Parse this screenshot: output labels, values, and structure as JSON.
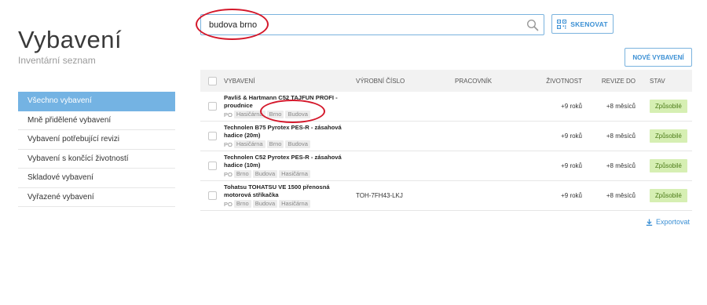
{
  "header": {
    "title": "Vybavení",
    "subtitle": "Inventární seznam"
  },
  "search": {
    "value": "budova brno",
    "placeholder": ""
  },
  "toolbar": {
    "scan_label": "SKENOVAT",
    "new_label": "NOVÉ VYBAVENÍ",
    "export_label": "Exportovat"
  },
  "sidebar": {
    "items": [
      {
        "label": "Všechno vybavení",
        "active": true
      },
      {
        "label": "Mně přidělené vybavení",
        "active": false
      },
      {
        "label": "Vybavení potřebující revizi",
        "active": false
      },
      {
        "label": "Vybavení s končící životností",
        "active": false
      },
      {
        "label": "Skladové vybavení",
        "active": false
      },
      {
        "label": "Vyřazené vybavení",
        "active": false
      }
    ]
  },
  "table": {
    "columns": [
      "VYBAVENÍ",
      "VÝROBNÍ ČÍSLO",
      "PRACOVNÍK",
      "ŽIVOTNOST",
      "REVIZE DO",
      "STAV"
    ],
    "rows": [
      {
        "title_line1": "Pavliš & Hartmann C52 TAJFUN PROFI -",
        "title_line2": "proudnice",
        "prefix": "PO",
        "tags": [
          "Hasičárna",
          "Brno",
          "Budova"
        ],
        "serial": "",
        "worker": "",
        "life": "+9 roků",
        "revision": "+8 měsíců",
        "status": "Způsobilé"
      },
      {
        "title_line1": "Technolen B75 Pyrotex PES-R - zásahová",
        "title_line2": "hadice (20m)",
        "prefix": "PO",
        "tags": [
          "Hasičárna",
          "Brno",
          "Budova"
        ],
        "serial": "",
        "worker": "",
        "life": "+9 roků",
        "revision": "+8 měsíců",
        "status": "Způsobilé"
      },
      {
        "title_line1": "Technolen C52 Pyrotex PES-R - zásahová",
        "title_line2": "hadice (10m)",
        "prefix": "PO",
        "tags": [
          "Brno",
          "Budova",
          "Hasičárna"
        ],
        "serial": "",
        "worker": "",
        "life": "+9 roků",
        "revision": "+8 měsíců",
        "status": "Způsobilé"
      },
      {
        "title_line1": "Tohatsu TOHATSU VE 1500 přenosná",
        "title_line2": "motorová stříkačka",
        "prefix": "PO",
        "tags": [
          "Brno",
          "Budova",
          "Hasičárna"
        ],
        "serial": "TOH-7FH43-LKJ",
        "worker": "",
        "life": "+9 roků",
        "revision": "+8 měsíců",
        "status": "Způsobilé"
      }
    ]
  },
  "icons": {
    "search": "search-icon",
    "scan": "qr-code-icon",
    "export": "download-icon"
  },
  "colors": {
    "accent": "#3a8fd4",
    "sidebar_active": "#74b3e3",
    "status_ok_bg": "#d6efb3",
    "status_ok_text": "#4a7a16",
    "annotation": "#d4182b"
  }
}
